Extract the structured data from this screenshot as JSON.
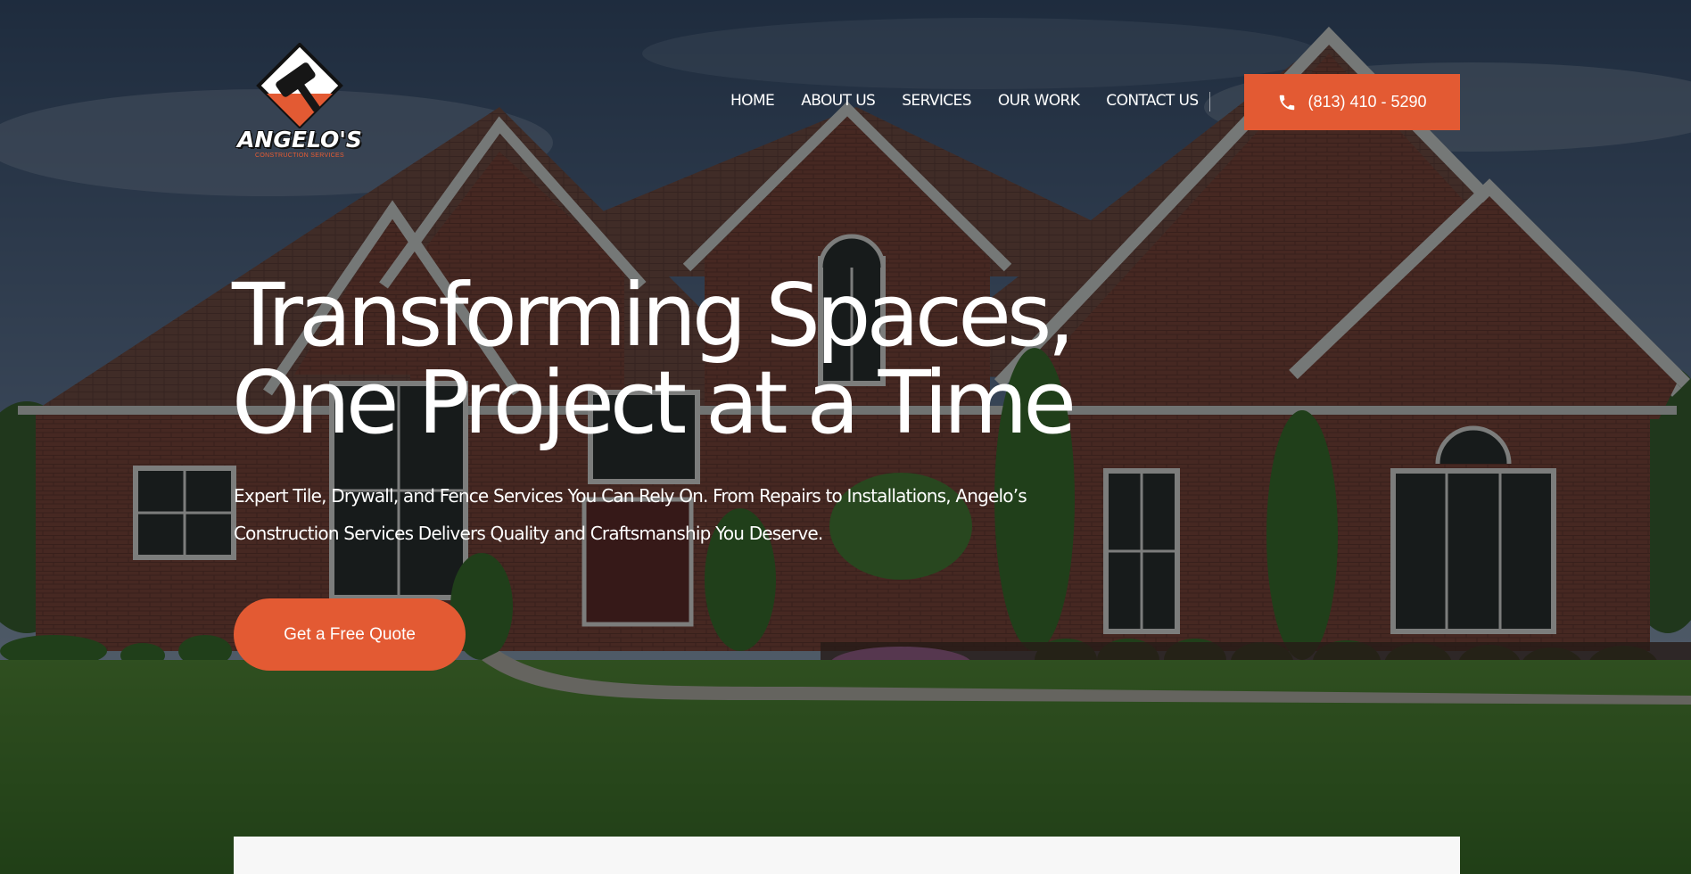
{
  "brand": {
    "name": "ANGELO'S",
    "tagline": "CONSTRUCTION SERVICES",
    "accent_color": "#e35a33"
  },
  "nav": {
    "items": [
      {
        "label": "HOME"
      },
      {
        "label": "ABOUT US"
      },
      {
        "label": "SERVICES"
      },
      {
        "label": "OUR WORK"
      },
      {
        "label": "CONTACT US"
      }
    ],
    "phone": {
      "label": "(813) 410 - 5290",
      "icon": "phone-icon"
    }
  },
  "hero": {
    "headline_line1": "Transforming Spaces,",
    "headline_line2": "One Project at a Time",
    "subheading": "Expert Tile, Drywall, and Fence Services You Can Rely On. From Repairs to Installations, Angelo’s Construction Services Delivers Quality and Craftsmanship You Deserve.",
    "cta_label": "Get a Free Quote",
    "background": "brick-house-photo"
  }
}
